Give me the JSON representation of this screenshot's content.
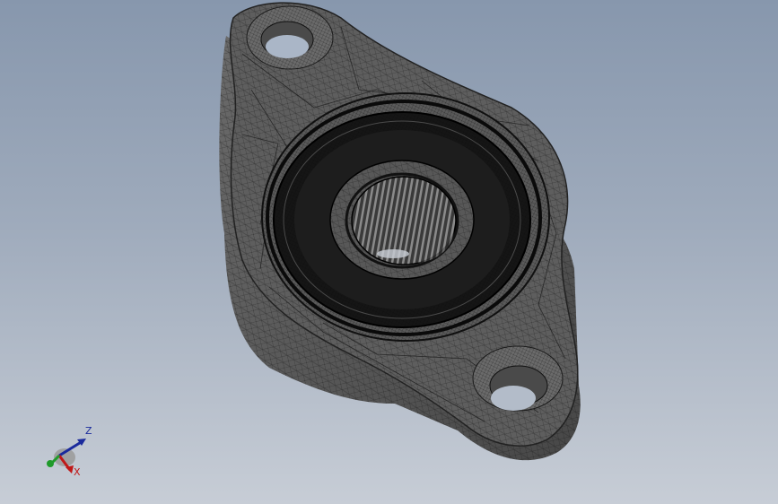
{
  "viewport": {
    "model_name": "flange-bearing-unit"
  },
  "triad": {
    "z_label": "Z",
    "x_label": "X",
    "colors": {
      "z": "#1a2a9c",
      "x": "#c01818",
      "y": "#1f9a2a"
    }
  },
  "colors": {
    "background_top": "#8797ad",
    "background_bottom": "#c7cdd6",
    "housing": "#5b5b5b",
    "bearing_seal": "#1b1b1b",
    "mesh_edges": "#141414"
  }
}
